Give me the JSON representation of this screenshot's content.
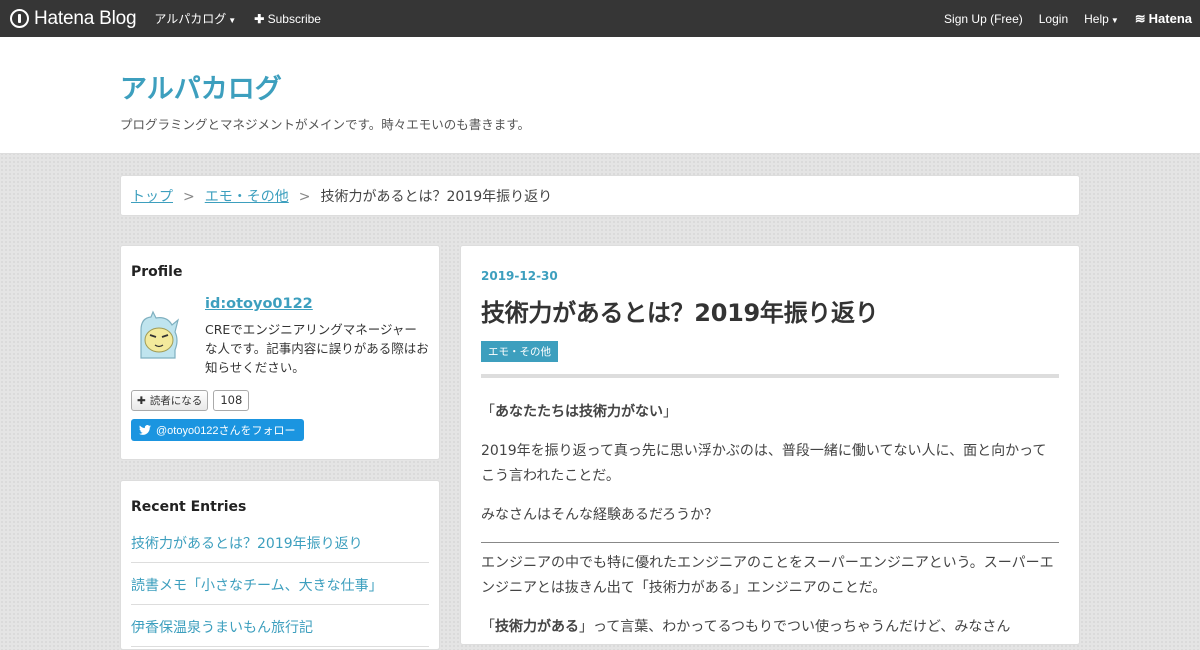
{
  "topbar": {
    "brand": "Hatena Blog",
    "blog_menu": "アルパカログ",
    "subscribe": "Subscribe",
    "signup": "Sign Up (Free)",
    "login": "Login",
    "help": "Help",
    "hatena": "Hatena"
  },
  "header": {
    "title": "アルパカログ",
    "description": "プログラミングとマネジメントがメインです。時々エモいのも書きます。"
  },
  "breadcrumb": {
    "top": "トップ",
    "category": "エモ・その他",
    "current": "技術力があるとは？2019年振り返り",
    "separator": ">"
  },
  "profile": {
    "heading": "Profile",
    "id": "id:otoyo0122",
    "bio": "CREでエンジニアリングマネージャーな人です。記事内容に誤りがある際はお知らせください。",
    "reader_button": "読者になる",
    "reader_count": "108",
    "twitter_follow": "@otoyo0122さんをフォロー"
  },
  "recent": {
    "heading": "Recent Entries",
    "items": [
      "技術力があるとは？2019年振り返り",
      "読書メモ「小さなチーム、大きな仕事」",
      "伊香保温泉うまいもん旅行記"
    ]
  },
  "entry": {
    "date": "2019-12-30",
    "title": "技術力があるとは？2019年振り返り",
    "category": "エモ・その他",
    "quote_open": "「",
    "quote_strong": "あなたたちは技術力がない",
    "quote_close": "」",
    "para2": "2019年を振り返って真っ先に思い浮かぶのは、普段一緒に働いてない人に、面と向かってこう言われたことだ。",
    "para3": "みなさんはそんな経験あるだろうか？",
    "para4": "エンジニアの中でも特に優れたエンジニアのことをスーパーエンジニアという。スーパーエンジニアとは抜きん出て「技術力がある」エンジニアのことだ。",
    "para5_open": "「",
    "para5_strong": "技術力がある",
    "para5_rest": "」って言葉、わかってるつもりでつい使っちゃうんだけど、みなさん"
  },
  "colors": {
    "accent": "#3d9fbe",
    "topbar": "#363636",
    "twitter": "#1b95e0"
  }
}
